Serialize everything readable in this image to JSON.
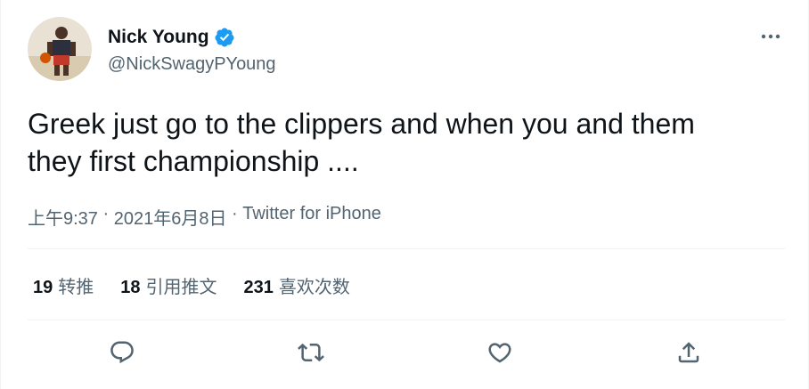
{
  "author": {
    "name": "Nick Young",
    "handle": "@NickSwagyPYoung",
    "verified_color": "#1d9bf0"
  },
  "tweet": {
    "text_line1": "Greek just go to the clippers and when you and them",
    "text_line2": "they first championship ...."
  },
  "meta": {
    "time": "上午9:37",
    "sep1": " · ",
    "date": "2021年6月8日",
    "sep2": " · ",
    "source": "Twitter for iPhone"
  },
  "stats": {
    "retweets_count": "19",
    "retweets_label": "转推",
    "quotes_count": "18",
    "quotes_label": "引用推文",
    "likes_count": "231",
    "likes_label": "喜欢次数"
  },
  "icons": {
    "more": "more-options-icon",
    "reply": "reply-icon",
    "retweet": "retweet-icon",
    "like": "like-icon",
    "share": "share-icon",
    "verified": "verified-badge-icon"
  },
  "colors": {
    "text_primary": "#0f1419",
    "text_secondary": "#536471",
    "divider": "#eff3f4",
    "accent": "#1d9bf0"
  }
}
